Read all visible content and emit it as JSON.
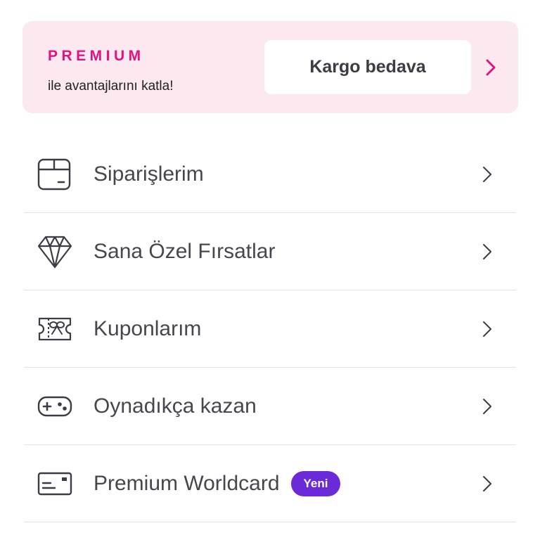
{
  "premium_banner": {
    "title": "PREMIUM",
    "subtitle": "ile avantajlarını katla!",
    "benefit": "Kargo bedava",
    "chevron_icon": "chevron-right-icon",
    "accent_color": "#e3137d",
    "background_color": "#fce8ef"
  },
  "menu": {
    "items": [
      {
        "label": "Siparişlerim",
        "icon": "package-box-icon"
      },
      {
        "label": "Sana Özel Fırsatlar",
        "icon": "diamond-icon"
      },
      {
        "label": "Kuponlarım",
        "icon": "gift-coupon-icon"
      },
      {
        "label": "Oynadıkça kazan",
        "icon": "gamepad-icon"
      },
      {
        "label": "Premium Worldcard",
        "icon": "credit-card-icon",
        "badge": "Yeni",
        "badge_color": "#6a2ad8"
      }
    ]
  }
}
